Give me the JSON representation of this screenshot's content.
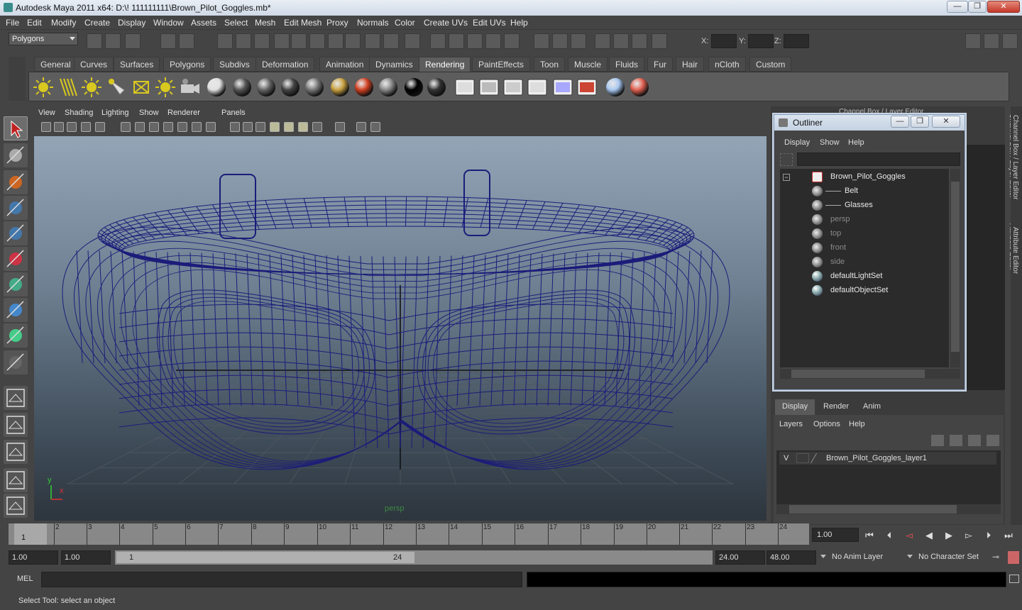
{
  "window": {
    "title": "Autodesk Maya 2011 x64: D:\\! 111111111\\Brown_Pilot_Goggles.mb*",
    "minimize": "—",
    "maximize": "❐",
    "close": "✕"
  },
  "menubar": [
    "File",
    "Edit",
    "Modify",
    "Create",
    "Display",
    "Window",
    "Assets",
    "Select",
    "Mesh",
    "Edit Mesh",
    "Proxy",
    "Normals",
    "Color",
    "Create UVs",
    "Edit UVs",
    "Help"
  ],
  "status": {
    "mode": "Polygons",
    "x_label": "X:",
    "y_label": "Y:",
    "z_label": "Z:"
  },
  "shelf_tabs": {
    "items": [
      "General",
      "Curves",
      "Surfaces",
      "Polygons",
      "Subdivs",
      "Deformation",
      "Animation",
      "Dynamics",
      "Rendering",
      "PaintEffects",
      "Toon",
      "Muscle",
      "Fluids",
      "Fur",
      "Hair",
      "nCloth",
      "Custom"
    ],
    "active": "Rendering"
  },
  "viewport": {
    "menu": [
      "View",
      "Shading",
      "Lighting",
      "Show",
      "Renderer",
      "Panels"
    ],
    "camera_label": "persp",
    "axis_y": "y",
    "axis_x": "x",
    "wire_color": "#1c1c7a"
  },
  "right_panel": {
    "channel_box_label": "Channel Box / Layer Editor",
    "side_tabs": [
      "Channel Box / Layer Editor",
      "Attribute Editor"
    ]
  },
  "outliner": {
    "title": "Outliner",
    "menu": [
      "Display",
      "Show",
      "Help"
    ],
    "items": [
      {
        "label": "Brown_Pilot_Goggles",
        "kind": "group",
        "dim": false
      },
      {
        "label": "Belt",
        "kind": "mesh",
        "dim": false
      },
      {
        "label": "Glasses",
        "kind": "mesh",
        "dim": false
      },
      {
        "label": "persp",
        "kind": "camera",
        "dim": true
      },
      {
        "label": "top",
        "kind": "camera",
        "dim": true
      },
      {
        "label": "front",
        "kind": "camera",
        "dim": true
      },
      {
        "label": "side",
        "kind": "camera",
        "dim": true
      },
      {
        "label": "defaultLightSet",
        "kind": "set",
        "dim": false
      },
      {
        "label": "defaultObjectSet",
        "kind": "set",
        "dim": false
      }
    ]
  },
  "layers": {
    "tabs": [
      "Display",
      "Render",
      "Anim"
    ],
    "active": "Display",
    "menu": [
      "Layers",
      "Options",
      "Help"
    ],
    "layer_visible": "V",
    "layer_name": "Brown_Pilot_Goggles_layer1"
  },
  "timeline": {
    "ticks": [
      "1",
      "2",
      "3",
      "4",
      "5",
      "6",
      "7",
      "8",
      "9",
      "10",
      "11",
      "12",
      "13",
      "14",
      "15",
      "16",
      "17",
      "18",
      "19",
      "20",
      "21",
      "22",
      "23",
      "24"
    ],
    "current_frame_label": "1",
    "current_time": "1.00"
  },
  "range": {
    "start": "1.00",
    "playback_start": "1.00",
    "slider_start": "1",
    "slider_end": "24",
    "playback_end": "24.00",
    "end": "48.00",
    "anim_layer": "No Anim Layer",
    "character_set": "No Character Set"
  },
  "command": {
    "label": "MEL"
  },
  "help": {
    "text": "Select Tool: select an object"
  }
}
